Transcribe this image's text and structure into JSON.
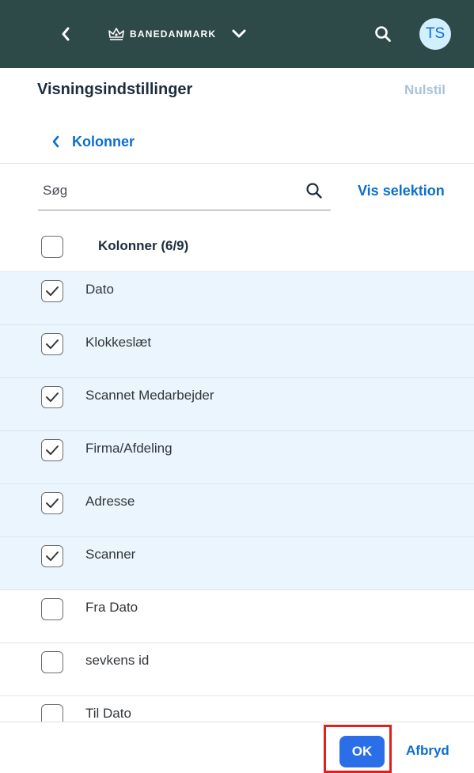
{
  "shell": {
    "logo_text": "BANEDANMARK",
    "avatar_initials": "TS"
  },
  "dialog": {
    "title": "Visningsindstillinger",
    "reset_label": "Nulstil",
    "back_label": "Kolonner"
  },
  "search": {
    "placeholder": "Søg",
    "show_selection_label": "Vis selektion"
  },
  "columns": {
    "header_label": "Kolonner (6/9)",
    "items": [
      {
        "label": "Dato",
        "checked": true
      },
      {
        "label": "Klokkeslæt",
        "checked": true
      },
      {
        "label": "Scannet Medarbejder",
        "checked": true
      },
      {
        "label": "Firma/Afdeling",
        "checked": true
      },
      {
        "label": "Adresse",
        "checked": true
      },
      {
        "label": "Scanner",
        "checked": true
      },
      {
        "label": "Fra Dato",
        "checked": false
      },
      {
        "label": "sevkens id",
        "checked": false
      },
      {
        "label": "Til Dato",
        "checked": false
      }
    ]
  },
  "footer": {
    "ok_label": "OK",
    "cancel_label": "Afbryd"
  },
  "colors": {
    "shell_bar": "#2e4a48",
    "accent": "#0a6ed1",
    "selected_row": "#ebf5fe",
    "ok_button": "#2a6ee8",
    "highlight_box": "#e0211b"
  }
}
